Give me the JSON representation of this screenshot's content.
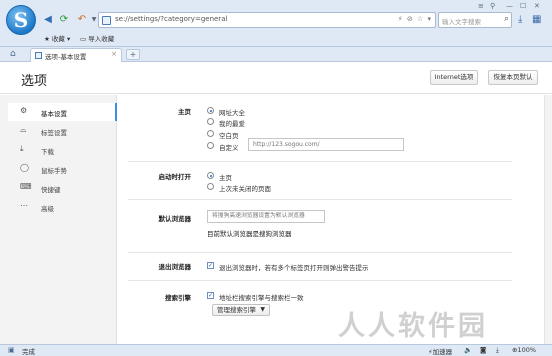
{
  "browser": {
    "url": "se://settings/?category=general",
    "search_placeholder": "输入文字搜索",
    "bookmarks": [
      "收藏",
      "导入收藏"
    ],
    "tab_title": "选项-基本设置",
    "nav_icons": [
      "back-arrow-icon",
      "refresh-icon",
      "undo-icon",
      "dropdown-icon"
    ],
    "colors": {
      "chrome": "#dfe9f5",
      "accent": "#3c8fe0",
      "logo": "#1b78c8"
    }
  },
  "header": {
    "title": "选项",
    "internet_options_label": "Internet选项",
    "restore_defaults_label": "恢复本页默认"
  },
  "sidebar": {
    "items": [
      {
        "label": "基本设置",
        "icon": "gear-icon",
        "active": true
      },
      {
        "label": "标签设置",
        "icon": "tab-icon"
      },
      {
        "label": "下载",
        "icon": "download-icon"
      },
      {
        "label": "鼠标手势",
        "icon": "mouse-icon"
      },
      {
        "label": "快捷键",
        "icon": "keyboard-icon"
      },
      {
        "label": "高级",
        "icon": "ellipsis-icon"
      }
    ]
  },
  "homepage": {
    "label": "主页",
    "options": [
      "网址大全",
      "我的最爱",
      "空白页",
      "自定义"
    ],
    "selected": "网址大全",
    "custom_url_placeholder": "http://123.sogou.com/"
  },
  "startup": {
    "label": "启动时打开",
    "options": [
      "主页",
      "上次未关闭的页面"
    ],
    "selected": "主页"
  },
  "default_browser": {
    "label": "默认浏览器",
    "button_label": "将搜狗高速浏览器设置为默认浏览器",
    "status_text": "目前默认浏览器是搜狗浏览器"
  },
  "exit_browser": {
    "label": "退出浏览器",
    "checkbox_label": "退出浏览器时，若有多个标签页打开则弹出警告提示",
    "checked": true
  },
  "search_engine": {
    "label": "搜索引擎",
    "checkbox_label": "地址栏搜索引擎与搜索栏一致",
    "checked": true,
    "manage_label": "管理搜索引擎"
  },
  "statusbar": {
    "status": "完成",
    "accelerator": "加速器",
    "zoom": "100%"
  },
  "watermark": "人人软件园"
}
